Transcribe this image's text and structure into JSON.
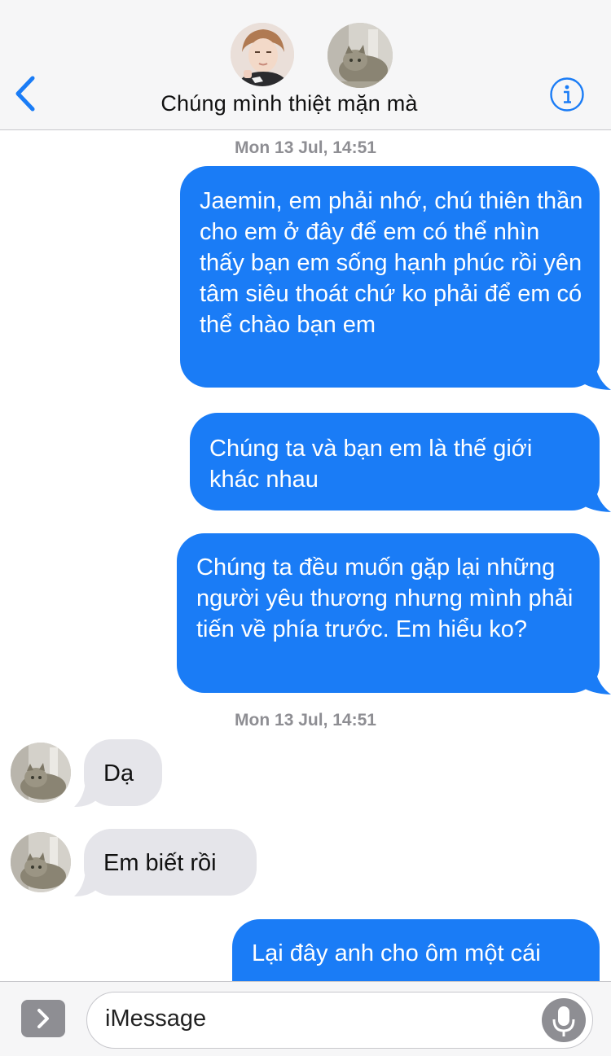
{
  "header": {
    "title": "Chúng mình thiệt mặn mà",
    "accent": "#1a7cf6"
  },
  "messages": [
    {
      "type": "timestamp",
      "text": "Mon 13 Jul, 14:51"
    },
    {
      "type": "sent",
      "text": "Jaemin, em phải nhớ, chú thiên thần cho em ở đây để em có thể nhìn thấy bạn em sống hạnh phúc rồi yên tâm siêu thoát chứ ko phải để em có thể chào bạn em"
    },
    {
      "type": "sent",
      "text": "Chúng ta và bạn em là thế giới khác nhau"
    },
    {
      "type": "sent",
      "text": "Chúng ta đều muốn gặp lại những người yêu thương nhưng mình phải tiến về phía trước. Em hiểu ko?"
    },
    {
      "type": "timestamp",
      "text": "Mon 13 Jul, 14:51"
    },
    {
      "type": "received",
      "text": "Dạ"
    },
    {
      "type": "received",
      "text": "Em biết rồi"
    },
    {
      "type": "sent",
      "text": "Lại đây anh cho ôm một cái"
    }
  ],
  "input": {
    "placeholder": "iMessage"
  },
  "colors": {
    "sent_bubble": "#1a7cf6",
    "received_bubble": "#e5e5ea",
    "timestamp": "#8e8e93",
    "bar_background": "#f6f6f7"
  },
  "icons": [
    "back-chevron-icon",
    "info-icon",
    "app-store-chevron-icon",
    "microphone-icon"
  ]
}
